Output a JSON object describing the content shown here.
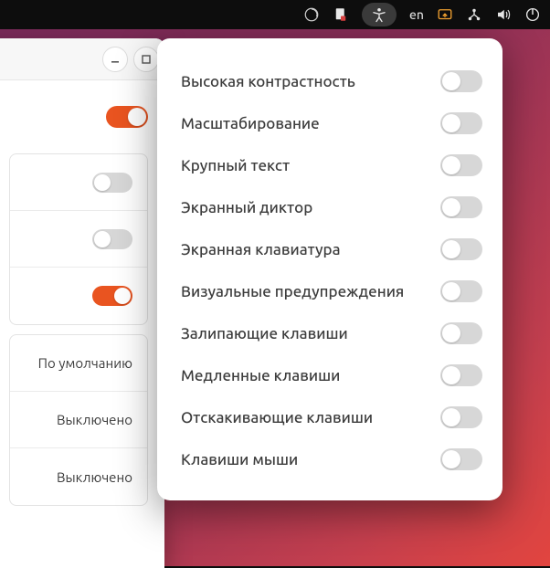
{
  "topbar": {
    "language": "en"
  },
  "window": {
    "rows": [
      {
        "label": "По умолчанию",
        "type": "text"
      },
      {
        "label": "Выключено",
        "type": "text"
      },
      {
        "label": "Выключено",
        "type": "text"
      }
    ]
  },
  "popover": {
    "items": [
      {
        "label": "Высокая контрастность",
        "on": false
      },
      {
        "label": "Масштабирование",
        "on": false
      },
      {
        "label": "Крупный текст",
        "on": false
      },
      {
        "label": "Экранный диктор",
        "on": false
      },
      {
        "label": "Экранная клавиатура",
        "on": false
      },
      {
        "label": "Визуальные предупреждения",
        "on": false
      },
      {
        "label": "Залипающие клавиши",
        "on": false
      },
      {
        "label": "Медленные клавиши",
        "on": false
      },
      {
        "label": "Отскакивающие клавиши",
        "on": false
      },
      {
        "label": "Клавиши мыши",
        "on": false
      }
    ]
  }
}
